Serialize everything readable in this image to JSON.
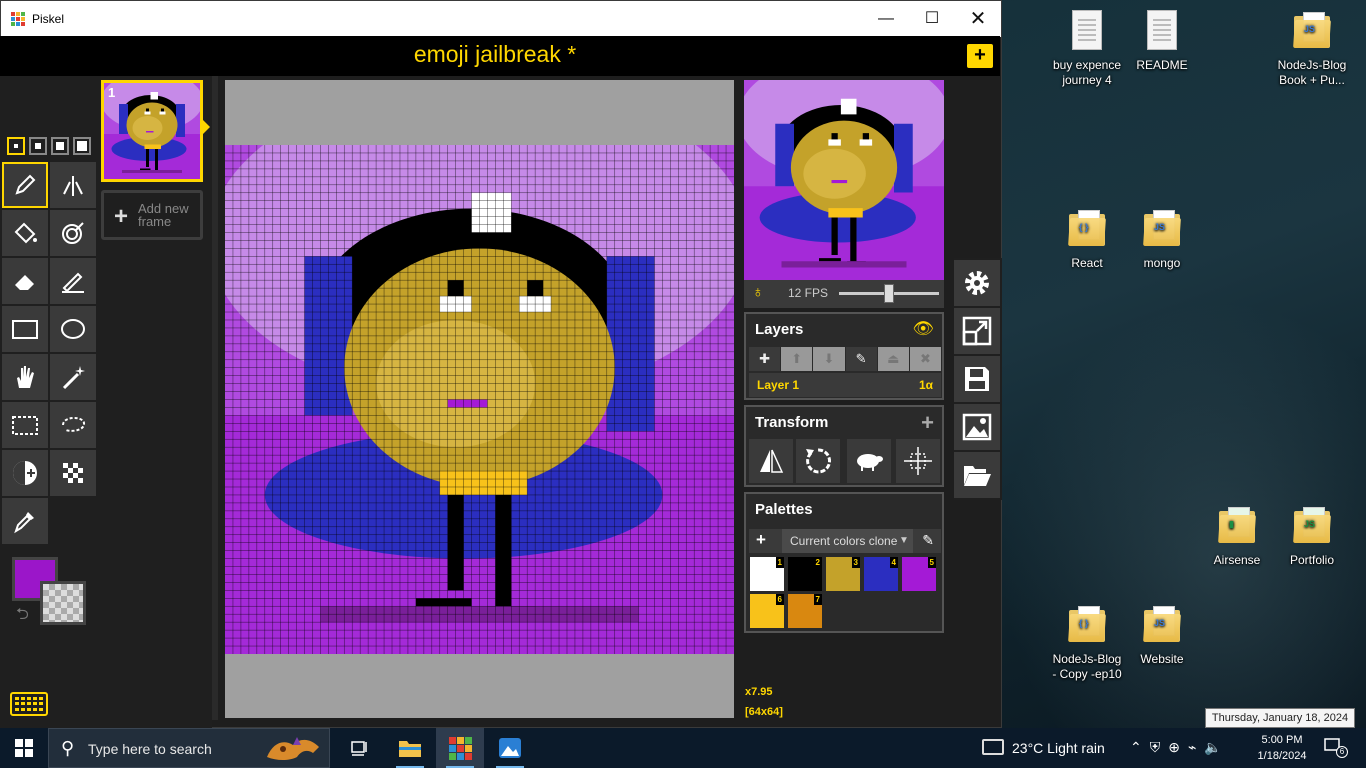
{
  "window": {
    "app_title": "Piskel",
    "min_icon": "minimize-icon",
    "max_icon": "maximize-icon",
    "close_icon": "close-icon"
  },
  "header": {
    "document_title": "emoji jailbreak *",
    "new_button_label": "+"
  },
  "tools": {
    "pen_sizes": 4,
    "selected_pen_size": 1,
    "items": [
      {
        "name": "pen-tool",
        "icon": "pencil-icon",
        "selected": true
      },
      {
        "name": "vertical-mirror-pen-tool",
        "icon": "mirror-pen-icon"
      },
      {
        "name": "paint-bucket-tool",
        "icon": "bucket-icon"
      },
      {
        "name": "paint-same-color-tool",
        "icon": "target-bucket-icon"
      },
      {
        "name": "eraser-tool",
        "icon": "eraser-icon"
      },
      {
        "name": "stroke-tool",
        "icon": "line-pen-icon"
      },
      {
        "name": "rectangle-tool",
        "icon": "rectangle-icon"
      },
      {
        "name": "circle-tool",
        "icon": "circle-icon"
      },
      {
        "name": "move-tool",
        "icon": "hand-icon"
      },
      {
        "name": "magic-wand-tool",
        "icon": "magic-wand-icon"
      },
      {
        "name": "rectangle-select-tool",
        "icon": "dashed-rectangle-icon"
      },
      {
        "name": "lasso-select-tool",
        "icon": "lasso-icon"
      },
      {
        "name": "lighten-tool",
        "icon": "lighten-icon"
      },
      {
        "name": "dithering-tool",
        "icon": "checker-icon"
      },
      {
        "name": "color-picker-tool",
        "icon": "eyedropper-icon"
      }
    ],
    "primary_color": "#9b16c9",
    "secondary_color": "transparent"
  },
  "frames": {
    "items": [
      {
        "number": "1"
      }
    ],
    "add_label": "Add new frame"
  },
  "canvas": {
    "zoom": "x7.95",
    "size": "[64x64]"
  },
  "preview": {
    "fps_label": "12 FPS",
    "fps_value": 12,
    "fps_max": 24
  },
  "layers": {
    "title": "Layers",
    "items": [
      {
        "name": "Layer 1",
        "opacity": "1α"
      }
    ]
  },
  "transform": {
    "title": "Transform"
  },
  "palettes": {
    "title": "Palettes",
    "selected": "Current colors clone",
    "colors": [
      {
        "index": "1",
        "hex": "#ffffff"
      },
      {
        "index": "2",
        "hex": "#000000"
      },
      {
        "index": "3",
        "hex": "#c4a22a"
      },
      {
        "index": "4",
        "hex": "#2b2ec0"
      },
      {
        "index": "5",
        "hex": "#a41ad6"
      },
      {
        "index": "6",
        "hex": "#f8c21a"
      },
      {
        "index": "7",
        "hex": "#d98810"
      }
    ]
  },
  "actions": [
    {
      "name": "settings-button",
      "icon": "gear-icon"
    },
    {
      "name": "resize-button",
      "icon": "resize-icon"
    },
    {
      "name": "save-button",
      "icon": "floppy-icon"
    },
    {
      "name": "export-button",
      "icon": "image-icon"
    },
    {
      "name": "import-button",
      "icon": "folder-open-icon"
    }
  ],
  "desktop": {
    "icons": [
      {
        "label": "buy expence journey 4",
        "icon": "document-icon"
      },
      {
        "label": "README",
        "icon": "document-icon"
      },
      {
        "label": "NodeJs-Blog Book + Pu...",
        "icon": "folder-icon"
      },
      {
        "label": "React",
        "icon": "folder-icon"
      },
      {
        "label": "mongo",
        "icon": "folder-icon"
      },
      {
        "label": "Airsense",
        "icon": "folder-icon"
      },
      {
        "label": "Portfolio",
        "icon": "folder-icon"
      },
      {
        "label": "NodeJs-Blog - Copy -ep10",
        "icon": "folder-icon"
      },
      {
        "label": "Website",
        "icon": "folder-icon"
      }
    ]
  },
  "taskbar": {
    "search_placeholder": "Type here to search",
    "weather": "23°C  Light rain",
    "time": "5:00 PM",
    "date": "1/18/2024",
    "notifications": "6",
    "tooltip": "Thursday, January 18, 2024"
  }
}
